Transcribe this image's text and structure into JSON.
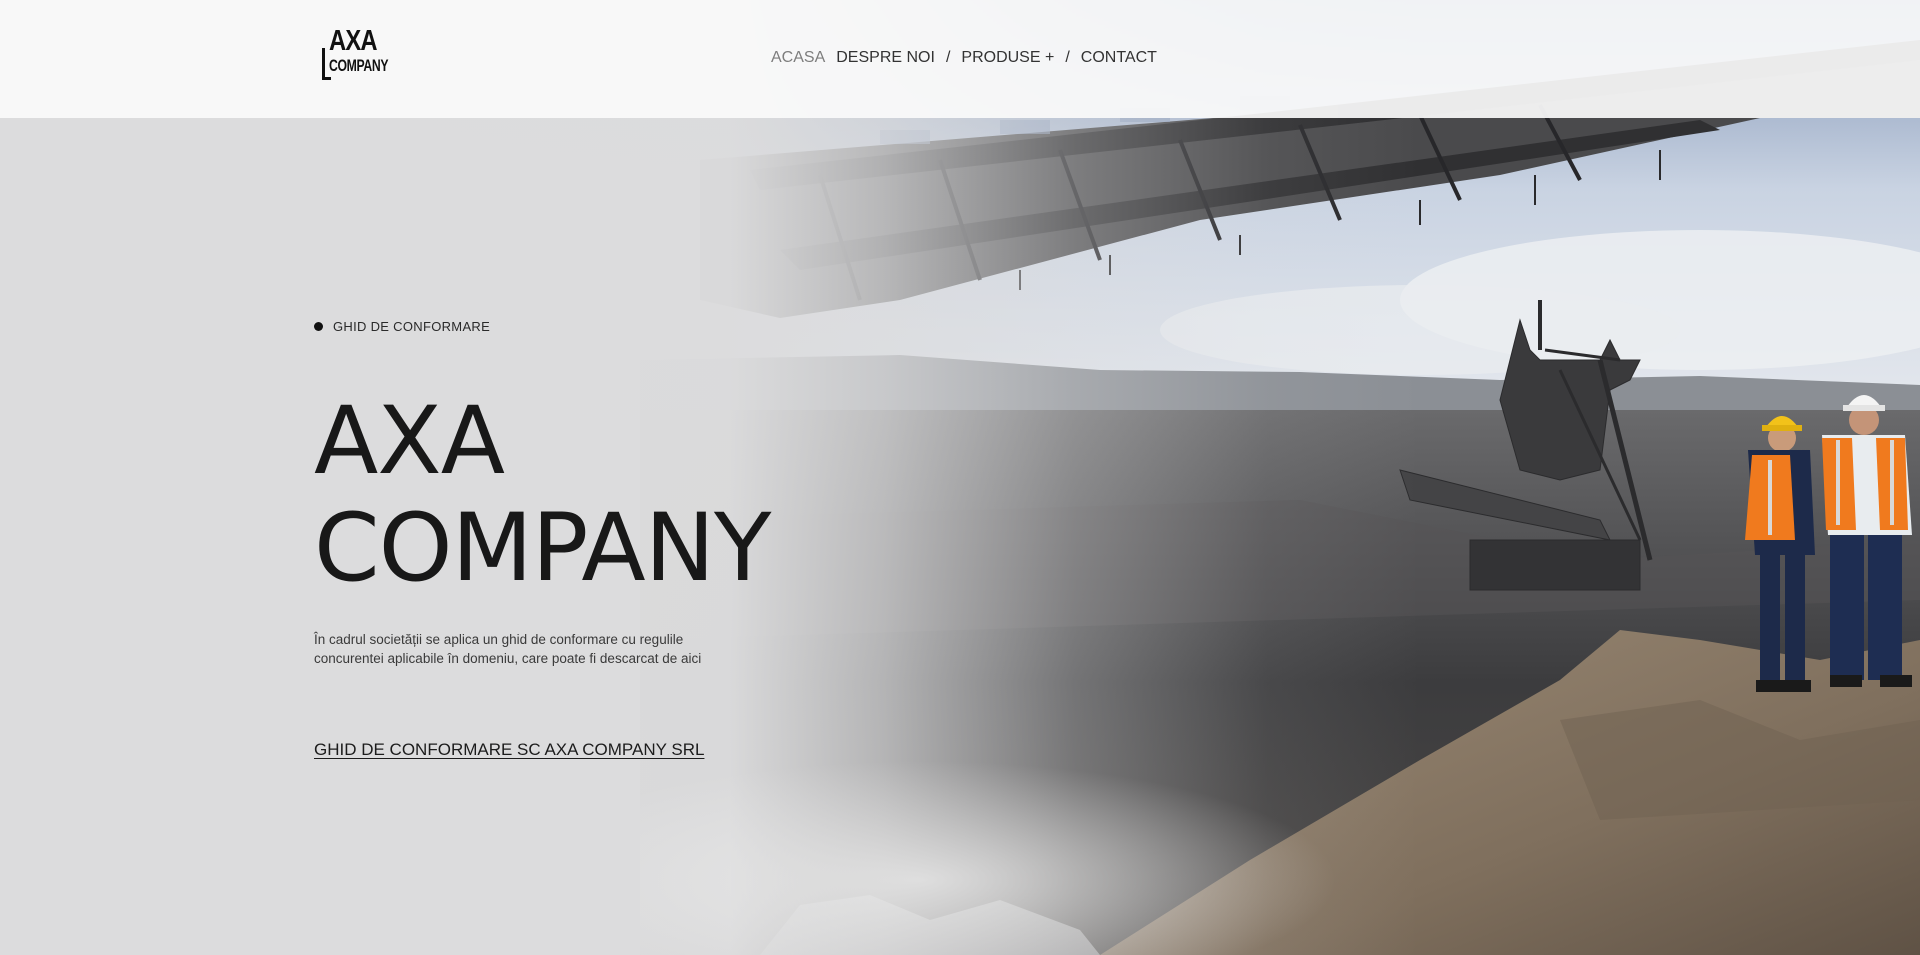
{
  "header": {
    "logo": {
      "line1": "AXA",
      "line2": "COMPANY"
    },
    "nav": {
      "items": [
        {
          "label": "ACASA",
          "active": true
        },
        {
          "label": "DESPRE NOI",
          "active": false
        },
        {
          "label": "PRODUSE +",
          "active": false
        },
        {
          "label": "CONTACT",
          "active": false
        }
      ],
      "separator": "/"
    }
  },
  "hero": {
    "eyebrow": "GHID DE CONFORMARE",
    "title_line1": "AXA",
    "title_line2": "COMPANY",
    "description": "În cadrul societății se aplica un ghid de conformare cu regulile concurentei aplicabile în domeniu, care poate fi descarcat de aici",
    "link_label": "GHID DE CONFORMARE SC AXA COMPANY SRL"
  },
  "colors": {
    "header_bg": "#fafafa",
    "text_primary": "#181818",
    "nav_active": "#7d7d7d",
    "hero_bg": "#dcdcdd",
    "vest_orange": "#f07a1e",
    "helmet_yellow": "#f2c21a",
    "sand": "#8a7a66"
  }
}
